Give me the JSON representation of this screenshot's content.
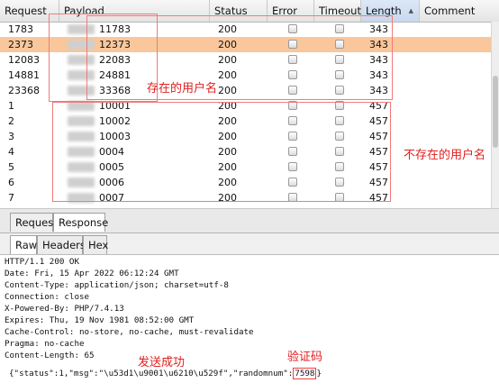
{
  "table": {
    "columns": [
      {
        "id": "request",
        "label": "Request"
      },
      {
        "id": "payload",
        "label": "Payload"
      },
      {
        "id": "status",
        "label": "Status"
      },
      {
        "id": "error",
        "label": "Error"
      },
      {
        "id": "timeout",
        "label": "Timeout"
      },
      {
        "id": "length",
        "label": "Length"
      },
      {
        "id": "comment",
        "label": "Comment"
      }
    ],
    "sorted_column": "length",
    "rows": [
      {
        "request": "1783",
        "payload": "11783",
        "status": "200",
        "length": "343",
        "selected": false
      },
      {
        "request": "2373",
        "payload": "12373",
        "status": "200",
        "length": "343",
        "selected": true
      },
      {
        "request": "12083",
        "payload": "22083",
        "status": "200",
        "length": "343",
        "selected": false
      },
      {
        "request": "14881",
        "payload": "24881",
        "status": "200",
        "length": "343",
        "selected": false
      },
      {
        "request": "23368",
        "payload": "33368",
        "status": "200",
        "length": "343",
        "selected": false
      },
      {
        "request": "1",
        "payload": "10001",
        "status": "200",
        "length": "457",
        "selected": false
      },
      {
        "request": "2",
        "payload": "10002",
        "status": "200",
        "length": "457",
        "selected": false
      },
      {
        "request": "3",
        "payload": "10003",
        "status": "200",
        "length": "457",
        "selected": false
      },
      {
        "request": "4",
        "payload": "0004",
        "status": "200",
        "length": "457",
        "selected": false
      },
      {
        "request": "5",
        "payload": "0005",
        "status": "200",
        "length": "457",
        "selected": false
      },
      {
        "request": "6",
        "payload": "0006",
        "status": "200",
        "length": "457",
        "selected": false
      },
      {
        "request": "7",
        "payload": "0007",
        "status": "200",
        "length": "457",
        "selected": false
      }
    ]
  },
  "annotations": {
    "existing_users": "存在的用户名",
    "nonexistent_users": "不存在的用户名",
    "send_success": "发送成功",
    "captcha": "验证码"
  },
  "tabs": {
    "request": "Request",
    "response": "Response",
    "active": "response"
  },
  "subtabs": {
    "raw": "Raw",
    "headers": "Headers",
    "hex": "Hex",
    "active": "raw"
  },
  "response": {
    "headers": [
      "HTTP/1.1 200 OK",
      "Date: Fri, 15 Apr 2022 06:12:24 GMT",
      "Content-Type: application/json; charset=utf-8",
      "Connection: close",
      "X-Powered-By: PHP/7.4.13",
      "Expires: Thu, 19 Nov 1981 08:52:00 GMT",
      "Cache-Control: no-store, no-cache, must-revalidate",
      "Pragma: no-cache",
      "Content-Length: 65"
    ],
    "body_prefix": "{\"status\":1,\"msg\":\"\\u53d1\\u9001\\u6210\\u529f\",\"randomnum\":",
    "body_code": "7598",
    "body_suffix": "}"
  },
  "colors": {
    "selected_row": "#f9c79b",
    "annotation": "#e01e1e",
    "sorted_header": "#c7d9ee"
  }
}
